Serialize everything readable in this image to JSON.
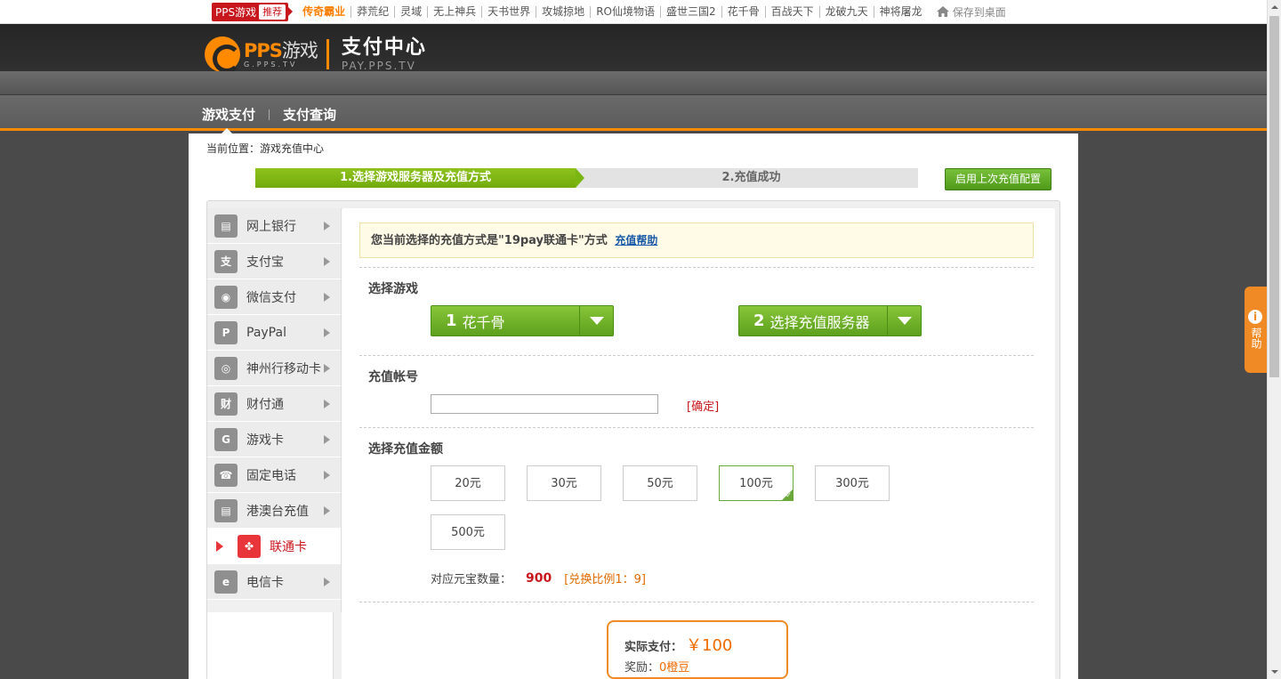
{
  "topbar": {
    "brand": "PPS游戏",
    "recommend": "推荐",
    "links": [
      "传奇霸业",
      "莽荒纪",
      "灵域",
      "无上神兵",
      "天书世界",
      "攻城掠地",
      "RO仙境物语",
      "盛世三国2",
      "花千骨",
      "百战天下",
      "龙破九天",
      "神将屠龙"
    ],
    "save_desktop": "保存到桌面"
  },
  "header": {
    "logo_main": "PPS",
    "logo_sub": "游戏",
    "logo_domain": "G.PPS.TV",
    "title": "支付中心",
    "domain": "PAY.PPS.TV"
  },
  "nav": {
    "tabs": [
      "游戏支付",
      "支付查询"
    ]
  },
  "breadcrumb": "当前位置：游戏充值中心",
  "steps": {
    "step1": "1.选择游戏服务器及充值方式",
    "step2": "2.充值成功"
  },
  "reuse_button": "启用上次充值配置",
  "sidebar": {
    "items": [
      {
        "label": "网上银行",
        "icon": "bank-card-icon",
        "glyph": "▤"
      },
      {
        "label": "支付宝",
        "icon": "alipay-icon",
        "glyph": "支"
      },
      {
        "label": "微信支付",
        "icon": "wechat-icon",
        "glyph": "◉"
      },
      {
        "label": "PayPal",
        "icon": "paypal-icon",
        "glyph": "P"
      },
      {
        "label": "神州行移动卡",
        "icon": "china-mobile-icon",
        "glyph": "◎"
      },
      {
        "label": "财付通",
        "icon": "tenpay-icon",
        "glyph": "财"
      },
      {
        "label": "游戏卡",
        "icon": "game-card-icon",
        "glyph": "G"
      },
      {
        "label": "固定电话",
        "icon": "telephone-icon",
        "glyph": "☎"
      },
      {
        "label": "港澳台充值",
        "icon": "hk-macau-tw-card-icon",
        "glyph": "▤"
      },
      {
        "label": "联通卡",
        "icon": "china-unicom-icon",
        "glyph": "✤"
      },
      {
        "label": "电信卡",
        "icon": "china-telecom-icon",
        "glyph": "e"
      }
    ],
    "active_index": 9
  },
  "notice": {
    "text": "您当前选择的充值方式是\"19pay联通卡\"方式",
    "help_link": "充值帮助"
  },
  "game_section": {
    "title": "选择游戏",
    "game_num": "1",
    "game_value": "花千骨",
    "server_num": "2",
    "server_value": "选择充值服务器"
  },
  "account_section": {
    "title": "充值帐号",
    "value": "",
    "confirm": "[确定]"
  },
  "amount_section": {
    "title": "选择充值金额",
    "options": [
      "20元",
      "30元",
      "50元",
      "100元",
      "300元",
      "500元"
    ],
    "selected": "100元"
  },
  "yuanbao": {
    "label": "对应元宝数量：",
    "value": "900",
    "ratio": "[兑换比例1：9]"
  },
  "payment": {
    "label": "实际支付：",
    "amount": "￥100",
    "reward_label": "奖励：",
    "reward_value": "0橙豆"
  },
  "help_tab": {
    "icon": "i",
    "label": "帮助"
  },
  "colors": {
    "accent": "#ff8a00",
    "green": "#72ab08",
    "red": "#c8161d"
  }
}
